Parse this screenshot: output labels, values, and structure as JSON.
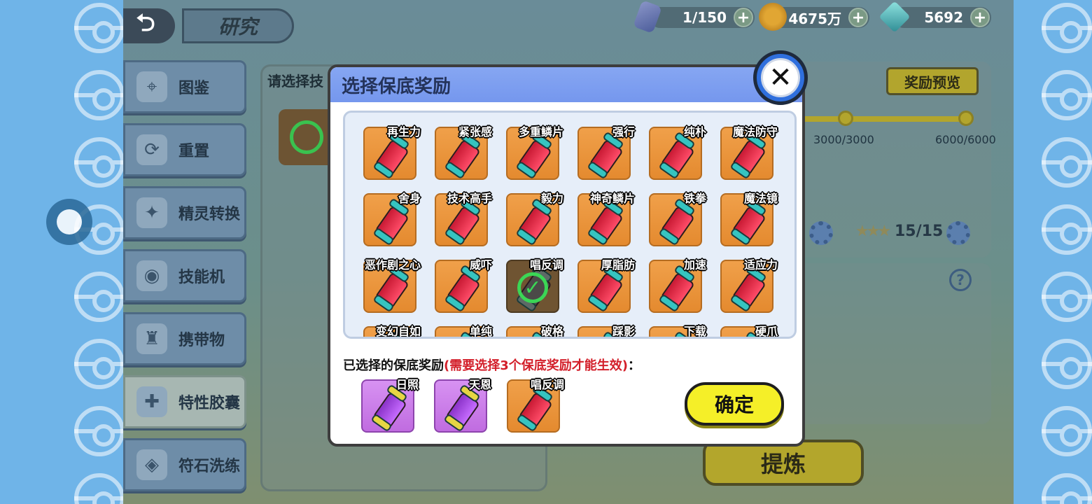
{
  "header": {
    "back_icon": "return-arrow-icon",
    "title": "研究"
  },
  "resources": [
    {
      "name": "ticket",
      "icon": "ticket-icon",
      "value": "1/150"
    },
    {
      "name": "coin",
      "icon": "coin-icon",
      "value": "4675万"
    },
    {
      "name": "diamond",
      "icon": "diamond-icon",
      "value": "5692"
    }
  ],
  "sidebar": {
    "items": [
      {
        "label": "图鉴",
        "icon": "pokedex-icon",
        "glyph": "⌖"
      },
      {
        "label": "重置",
        "icon": "refresh-icon",
        "glyph": "⟳"
      },
      {
        "label": "精灵转换",
        "icon": "pokemon-silhouette-icon",
        "glyph": "✦"
      },
      {
        "label": "技能机",
        "icon": "disc-icon",
        "glyph": "◉"
      },
      {
        "label": "携带物",
        "icon": "bag-icon",
        "glyph": "♜"
      },
      {
        "label": "特性胶囊",
        "icon": "capsule-icon",
        "glyph": "✚"
      },
      {
        "label": "符石洗练",
        "icon": "rune-icon",
        "glyph": "◈"
      }
    ],
    "active_index": 5
  },
  "background_panel": {
    "prompt": "请选择技",
    "reward_preview": "奖励预览",
    "progress_labels": [
      "3000/3000",
      "6000/6000"
    ],
    "stars": "15/15",
    "refine": "提炼",
    "help": "?"
  },
  "modal": {
    "title": "选择保底奖励",
    "close_icon": "close-icon",
    "options": [
      {
        "label": "再生力",
        "selected": false
      },
      {
        "label": "紧张感",
        "selected": false
      },
      {
        "label": "多重鳞片",
        "selected": false
      },
      {
        "label": "强行",
        "selected": false
      },
      {
        "label": "纯朴",
        "selected": false
      },
      {
        "label": "魔法防守",
        "selected": false
      },
      {
        "label": "舍身",
        "selected": false
      },
      {
        "label": "技术高手",
        "selected": false
      },
      {
        "label": "毅力",
        "selected": false
      },
      {
        "label": "神奇鳞片",
        "selected": false
      },
      {
        "label": "铁拳",
        "selected": false
      },
      {
        "label": "魔法镜",
        "selected": false
      },
      {
        "label": "恶作剧之心",
        "selected": false
      },
      {
        "label": "威吓",
        "selected": false
      },
      {
        "label": "唱反调",
        "selected": true
      },
      {
        "label": "厚脂肪",
        "selected": false
      },
      {
        "label": "加速",
        "selected": false
      },
      {
        "label": "适应力",
        "selected": false
      },
      {
        "label": "变幻自如",
        "selected": false
      },
      {
        "label": "单纯",
        "selected": false
      },
      {
        "label": "破格",
        "selected": false
      },
      {
        "label": "踩影",
        "selected": false
      },
      {
        "label": "下载",
        "selected": false
      },
      {
        "label": "硬爪",
        "selected": false
      }
    ],
    "selected_label_prefix": "已选择的保底奖励",
    "selected_label_warning": "(需要选择3个保底奖励才能生效)",
    "selected_label_suffix": "：",
    "selected": [
      {
        "label": "日照",
        "color": "purple"
      },
      {
        "label": "天恩",
        "color": "purple"
      },
      {
        "label": "唱反调",
        "color": "orange"
      }
    ],
    "confirm": "确定"
  },
  "colors": {
    "modal_header": "#7597ee",
    "tile_orange": "#e48a2f",
    "tile_purple": "#c06ce0",
    "confirm_yellow": "#f5ef28",
    "warning_red": "#d31f2a",
    "check_green": "#3bd655"
  }
}
